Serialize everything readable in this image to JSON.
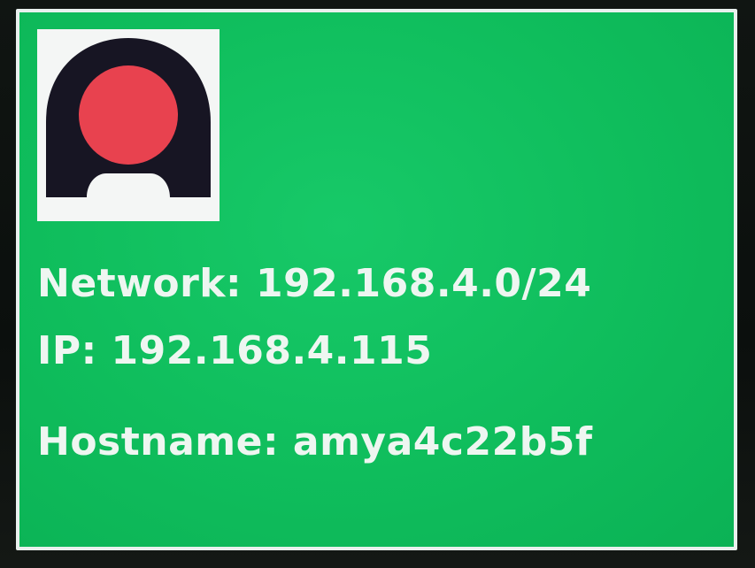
{
  "display": {
    "logo": {
      "icon": "logo-icon",
      "colors": {
        "tile": "#f4f6f5",
        "arch": "#171523",
        "dot": "#e8424f"
      }
    },
    "network_line": "Network: 192.168.4.0/24",
    "ip_line": "IP: 192.168.4.115",
    "hostname_line": "Hostname: amya4c22b5f",
    "colors": {
      "background": "#0fbd5c",
      "text": "#eef6f1",
      "border": "#e9f0ee"
    }
  }
}
